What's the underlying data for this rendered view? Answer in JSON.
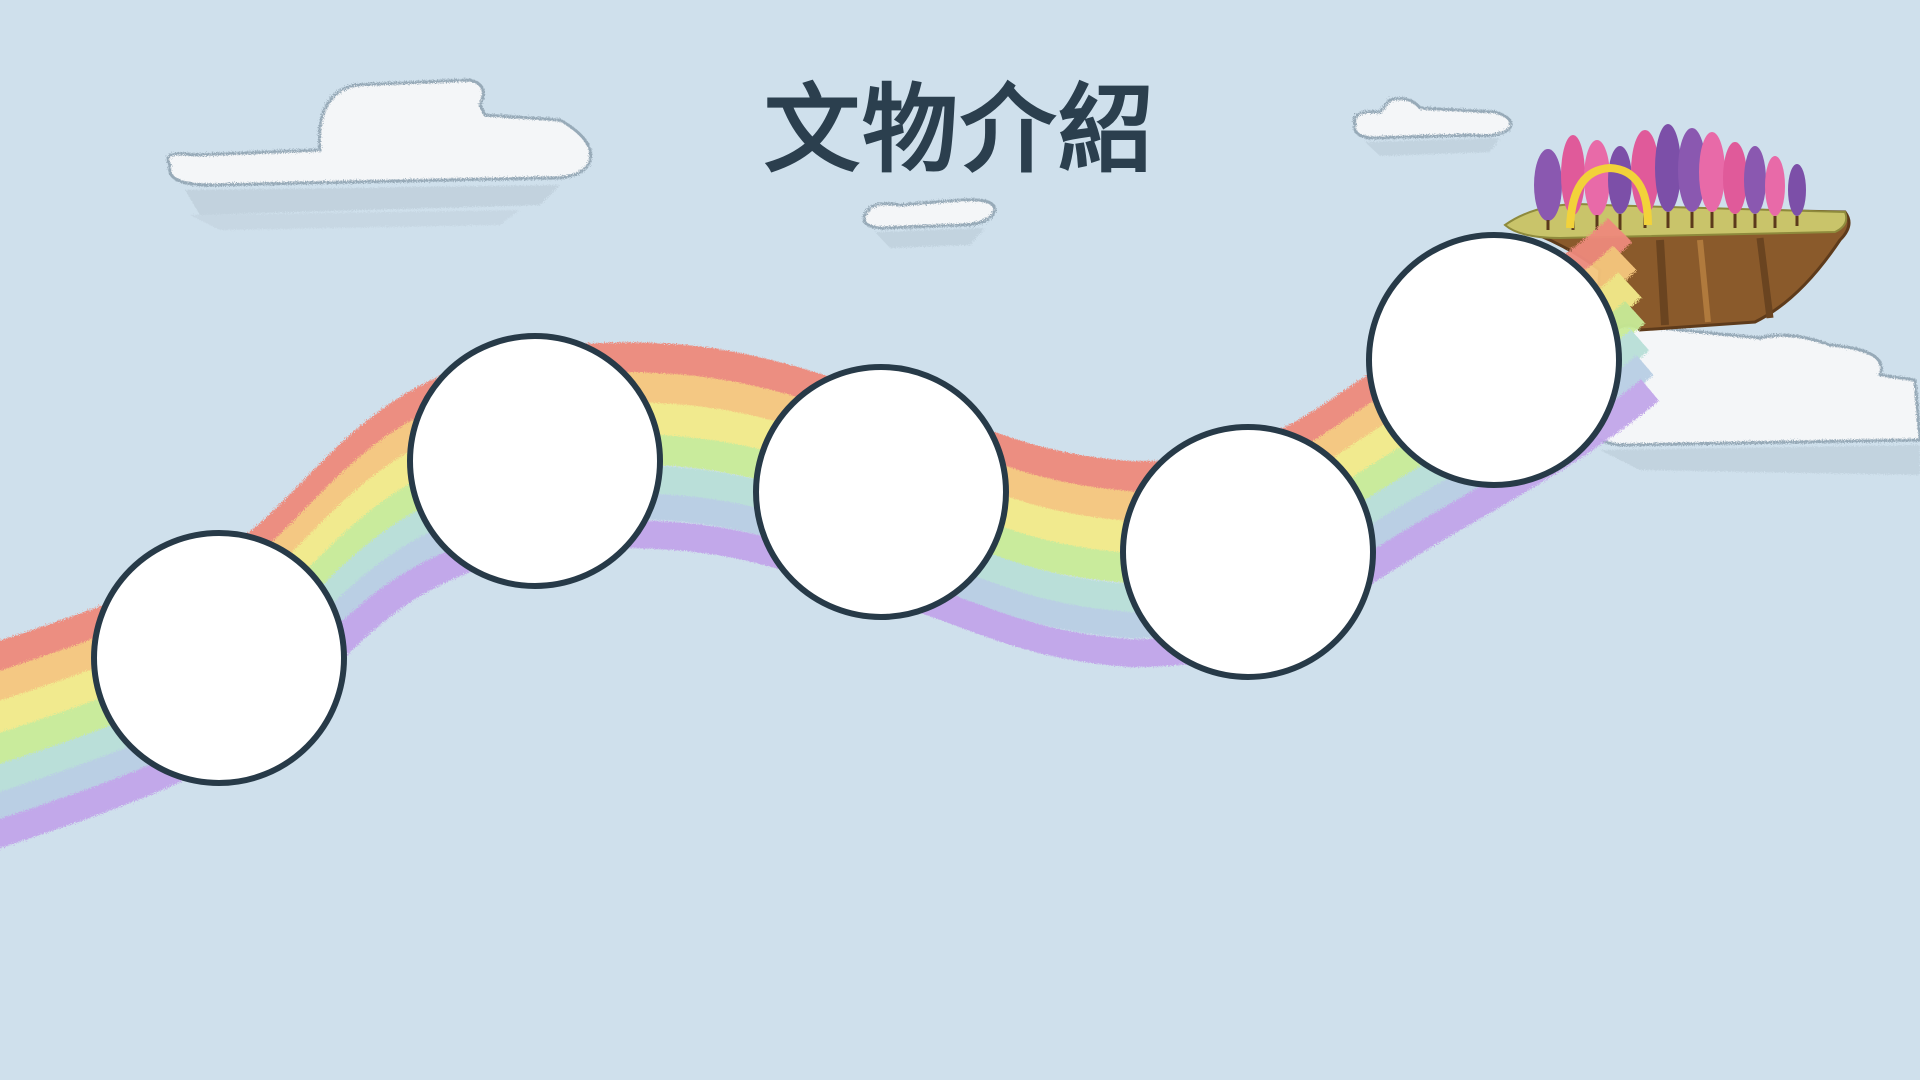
{
  "slide": {
    "title": "文物介紹",
    "background_color": "#cfe0ec",
    "circle_fill": "#ffffff",
    "circle_stroke": "#273a48",
    "rainbow_colors": [
      "#ee8a7c",
      "#f6c77e",
      "#f3eb8a",
      "#c9ec98",
      "#b9dfd8",
      "#b9cfe4",
      "#c2a6ea"
    ]
  },
  "decorations": {
    "clouds": [
      "cloud-large-left",
      "cloud-small-center",
      "cloud-small-right",
      "cloud-island-right"
    ],
    "island": "floating-island-with-trees-and-arch"
  }
}
